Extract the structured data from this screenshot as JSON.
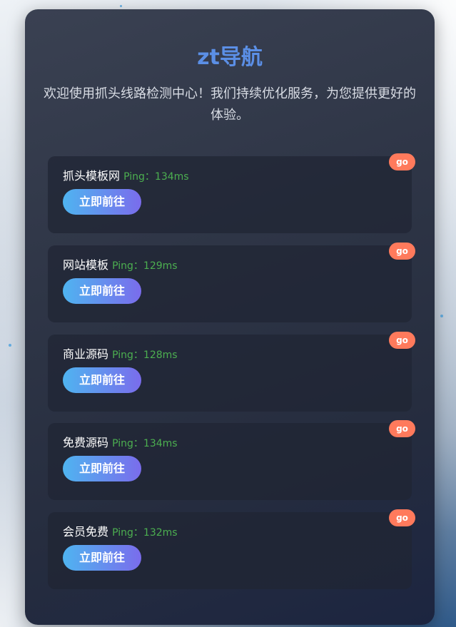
{
  "header": {
    "title": "zt导航",
    "welcome": "欢迎使用抓头线路检测中心！我们持续优化服务，为您提供更好的体验。"
  },
  "sites": [
    {
      "name": "抓头模板网",
      "ping_label": "Ping：",
      "ping_value": "134ms",
      "button": "立即前往",
      "badge": "go"
    },
    {
      "name": "网站模板",
      "ping_label": "Ping：",
      "ping_value": "129ms",
      "button": "立即前往",
      "badge": "go"
    },
    {
      "name": "商业源码",
      "ping_label": "Ping：",
      "ping_value": "128ms",
      "button": "立即前往",
      "badge": "go"
    },
    {
      "name": "免费源码",
      "ping_label": "Ping：",
      "ping_value": "134ms",
      "button": "立即前往",
      "badge": "go"
    },
    {
      "name": "会员免费",
      "ping_label": "Ping：",
      "ping_value": "132ms",
      "button": "立即前往",
      "badge": "go"
    }
  ],
  "colors": {
    "title": "#5b8fe6",
    "ping": "#4caf50",
    "badge": "#ff7a5c",
    "button_gradient_start": "#4fb4f0",
    "button_gradient_end": "#7a6cec"
  }
}
